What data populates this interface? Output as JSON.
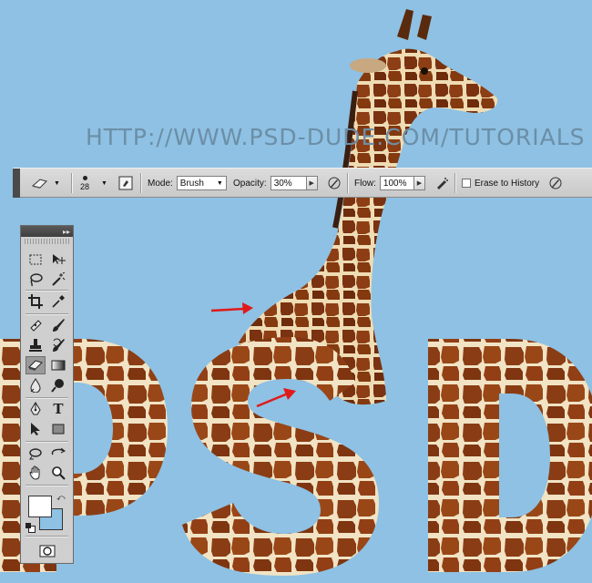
{
  "watermark": "HTTP://WWW.PSD-DUDE.COM/TUTORIALS",
  "artwork_text": "PSD",
  "options_bar": {
    "brush_size": "28",
    "mode_label": "Mode:",
    "mode_value": "Brush",
    "opacity_label": "Opacity:",
    "opacity_value": "30%",
    "flow_label": "Flow:",
    "flow_value": "100%",
    "erase_history_label": "Erase to History"
  },
  "tools_panel": {
    "collapse_glyph": "▸▸",
    "tools": [
      {
        "name": "rectangular-marquee-icon"
      },
      {
        "name": "move-icon"
      },
      {
        "name": "lasso-icon"
      },
      {
        "name": "magic-wand-icon"
      },
      {
        "name": "crop-icon"
      },
      {
        "name": "eyedropper-icon"
      },
      {
        "name": "spot-healing-icon"
      },
      {
        "name": "brush-icon"
      },
      {
        "name": "clone-stamp-icon"
      },
      {
        "name": "history-brush-icon"
      },
      {
        "name": "eraser-icon"
      },
      {
        "name": "gradient-icon"
      },
      {
        "name": "blur-icon"
      },
      {
        "name": "dodge-icon"
      },
      {
        "name": "pen-icon"
      },
      {
        "name": "type-icon"
      },
      {
        "name": "path-selection-icon"
      },
      {
        "name": "rectangle-shape-icon"
      },
      {
        "name": "3d-rotate-icon"
      },
      {
        "name": "3d-orbit-icon"
      },
      {
        "name": "hand-icon"
      },
      {
        "name": "zoom-icon"
      }
    ],
    "type_glyph": "T",
    "foreground_color": "#ffffff",
    "background_color": "#8ec1e3"
  },
  "colors": {
    "canvas_bg": "#8ec1e3",
    "fur_dark": "#8a3d14",
    "fur_light": "#f1e3c4",
    "arrow": "#e01a1a"
  }
}
